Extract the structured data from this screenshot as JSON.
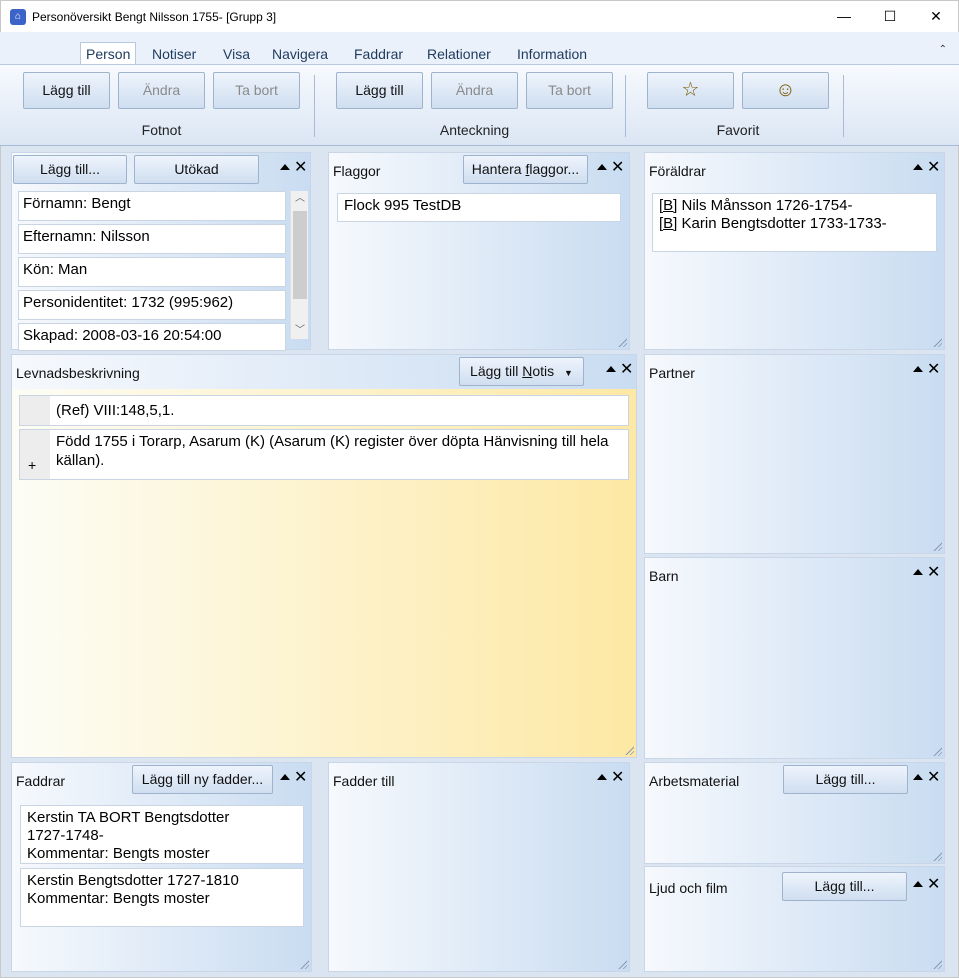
{
  "window": {
    "title": "Personöversikt Bengt Nilsson 1755- [Grupp 3]",
    "minimize": "—",
    "maximize": "☐",
    "close": "✕",
    "icon": "family-tree-icon"
  },
  "ribbon": {
    "tabs": [
      "Person",
      "Notiser",
      "Visa",
      "Navigera",
      "Faddrar",
      "Relationer",
      "Information"
    ],
    "collapse": "⌃",
    "groups": [
      {
        "label": "Fotnot",
        "buttons": [
          "Lägg till",
          "Ändra",
          "Ta bort"
        ]
      },
      {
        "label": "Anteckning",
        "buttons": [
          "Lägg till",
          "Ändra",
          "Ta bort"
        ]
      },
      {
        "label": "Favorit",
        "buttons": [
          "☆",
          "☺"
        ]
      }
    ]
  },
  "person_panel": {
    "add_button": "Lägg till...",
    "expand_button": "Utökad",
    "fields": [
      "Förnamn: Bengt",
      "Efternamn: Nilsson",
      "Kön: Man",
      "Personidentitet: 1732 (995:962)",
      "Skapad: 2008-03-16 20:54:00"
    ]
  },
  "flags_panel": {
    "title": "Flaggor",
    "button_pre": "Hantera ",
    "button_u": "f",
    "button_post": "laggor...",
    "items": [
      "Flock 995 TestDB"
    ]
  },
  "parents_panel": {
    "title": "Föräldrar",
    "items": [
      {
        "tag": "[B]",
        "name": "Nils Månsson 1726-1754-"
      },
      {
        "tag": "[B]",
        "name": "Karin Bengtsdotter 1733-1733-"
      }
    ]
  },
  "biography_panel": {
    "title": "Levnadsbeskrivning",
    "button_pre": "Lägg till ",
    "button_u": "N",
    "button_post": "otis",
    "notes": [
      "(Ref) VIII:148,5,1.",
      "Född 1755 i Torarp, Asarum (K) (Asarum (K) register över döpta Hänvisning till hela källan)."
    ],
    "expand": "+"
  },
  "partner_panel": {
    "title": "Partner"
  },
  "children_panel": {
    "title": "Barn"
  },
  "godparents_panel": {
    "title": "Faddrar",
    "button": "Lägg till ny fadder...",
    "items": [
      [
        "Kerstin TA BORT Bengtsdotter",
        "1727-1748-",
        "Kommentar: Bengts moster"
      ],
      [
        "Kerstin Bengtsdotter 1727-1810",
        "Kommentar: Bengts moster"
      ]
    ]
  },
  "godparent_of_panel": {
    "title": "Fadder till"
  },
  "work_material_panel": {
    "title": "Arbetsmaterial",
    "button": "Lägg till..."
  },
  "media_panel": {
    "title": "Ljud och film",
    "button": "Lägg till..."
  }
}
